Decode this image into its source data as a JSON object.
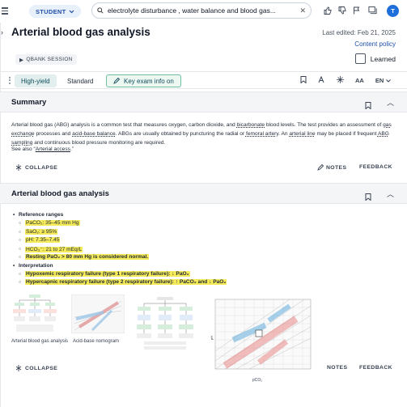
{
  "topbar": {
    "role_pill": "STUDENT",
    "search_query": "electrolyte disturbance , water balance and blood gas...",
    "avatar_initial": "T"
  },
  "article": {
    "title": "Arterial blood gas analysis",
    "last_edited": "Last edited: Feb 21, 2025",
    "content_policy": "Content policy",
    "qbank_label": "QBANK SESSION",
    "learned_label": "Learned"
  },
  "toolbar": {
    "tabs": [
      "High-yield",
      "Standard"
    ],
    "key_exam_label": "Key exam info on",
    "lang": "EN"
  },
  "summary": {
    "heading": "Summary",
    "text_1": "Arterial blood gas (ABG) analysis is a common test that measures oxygen, carbon dioxide, and ",
    "bicarbonate": "bicarbonate",
    "text_2": " blood levels. The test provides an assessment of ",
    "gas_exchange": "gas exchange",
    "text_3": " processes and ",
    "acid_base": "acid-base balance",
    "text_4": ". ABGs are usually obtained by puncturing the radial or ",
    "femoral": "femoral artery",
    "text_5": ". An ",
    "arterial_line": "arterial line",
    "text_6": " may be placed if frequent ",
    "abg_sampling": "ABG sampling",
    "text_7": " and continuous blood pressure monitoring are required.",
    "see_also_prefix": "See also “",
    "see_also_link": "Arterial access",
    "see_also_suffix": ".”",
    "collapse": "COLLAPSE",
    "notes": "NOTES",
    "feedback": "FEEDBACK"
  },
  "abg": {
    "heading": "Arterial blood gas analysis",
    "ref_ranges_label": "Reference ranges",
    "ranges": [
      "PaCO₂: 35–45 mm Hg",
      "SaO₂: ≥ 95%",
      "pH: 7.35–7.45",
      "HCO₃⁻: 21 to 27 mEq/L",
      "Resting PaO₂ > 80 mm Hg is considered normal."
    ],
    "interpretation_label": "Interpretation",
    "type1": "Hypoxemic respiratory failure (type 1 respiratory failure): ↓ PaO₂",
    "type2": "Hypercapnic respiratory failure (type 2 respiratory failure): ↑ PaCO₂ and ↓ PaO₂",
    "fig_captions": [
      "Arterial blood gas analysis",
      "Acid-base nomogram"
    ],
    "nomogram_axis": "pCO₂",
    "collapse": "COLLAPSE",
    "notes": "NOTES",
    "feedback": "FEEDBACK"
  },
  "colors": {
    "accent": "#1e6fd9",
    "highlight": "#f5ea5a",
    "key_border": "#6fbf9f"
  }
}
